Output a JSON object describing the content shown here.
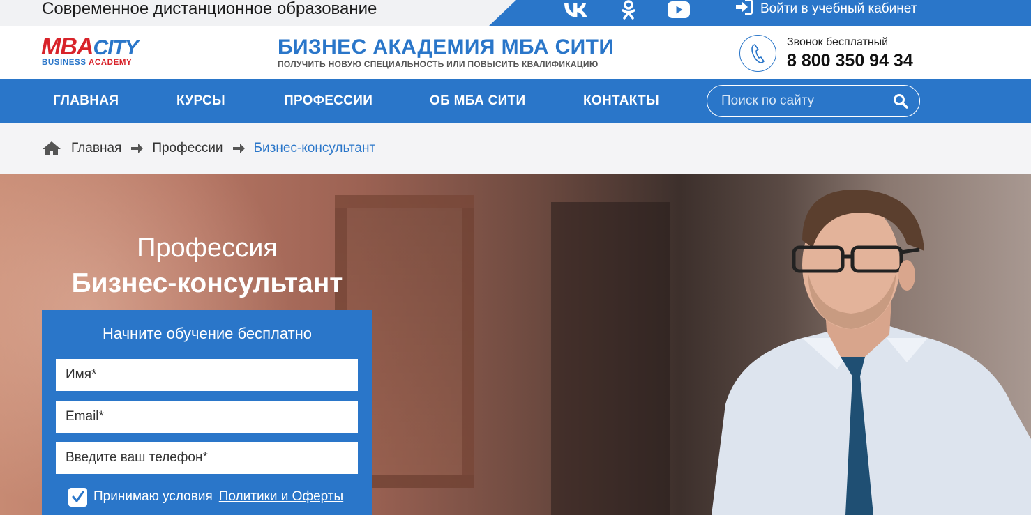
{
  "topbar": {
    "tagline": "Современное дистанционное образование",
    "social": [
      {
        "icon": "vk-icon"
      },
      {
        "icon": "odnoklassniki-icon"
      },
      {
        "icon": "youtube-icon"
      }
    ],
    "login_label": "Войти в учебный кабинет"
  },
  "header": {
    "logo_top_mba": "MBA",
    "logo_top_city": "CITY",
    "logo_bottom_business": "BUSINESS",
    "logo_bottom_academy": "ACADEMY",
    "title": "БИЗНЕС АКАДЕМИЯ МБА СИТИ",
    "subtitle": "ПОЛУЧИТЬ НОВУЮ СПЕЦИАЛЬНОСТЬ ИЛИ ПОВЫСИТЬ КВАЛИФИКАЦИЮ",
    "phone_label": "Звонок бесплатный",
    "phone_number": "8 800 350 94 34"
  },
  "nav": {
    "items": [
      {
        "label": "ГЛАВНАЯ"
      },
      {
        "label": "КУРСЫ"
      },
      {
        "label": "ПРОФЕССИИ"
      },
      {
        "label": "ОБ МБА СИТИ"
      },
      {
        "label": "КОНТАКТЫ"
      }
    ],
    "search_placeholder": "Поиск по сайту"
  },
  "breadcrumb": [
    {
      "label": "Главная"
    },
    {
      "label": "Профессии"
    },
    {
      "label": "Бизнес-консультант"
    }
  ],
  "hero": {
    "title_line1": "Профессия",
    "title_line2": "Бизнес-консультант"
  },
  "form": {
    "title": "Начните обучение бесплатно",
    "name_placeholder": "Имя*",
    "email_placeholder": "Email*",
    "phone_placeholder": "Введите ваш телефон*",
    "agree_text": "Принимаю условия",
    "agree_link": "Политики и Оферты",
    "agree_checked": true
  },
  "colors": {
    "accent": "#2a76c9",
    "logo_red": "#d8232a"
  }
}
